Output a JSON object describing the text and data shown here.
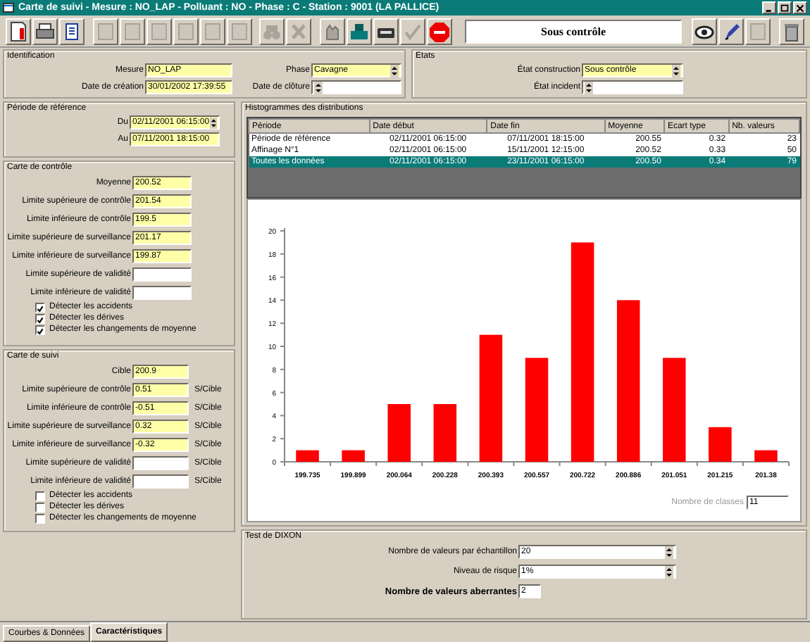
{
  "window": {
    "title": "Carte de suivi - Mesure : NO_LAP - Polluant : NO - Phase : C - Station : 9001 (LA PALLICE)"
  },
  "toolbar": {
    "buttons": [
      {
        "kind": "page",
        "disabled": false
      },
      {
        "kind": "printer",
        "disabled": false
      },
      {
        "kind": "doc",
        "disabled": false
      },
      {
        "kind": "blank",
        "disabled": true
      },
      {
        "kind": "blank",
        "disabled": true
      },
      {
        "kind": "blank",
        "disabled": true
      },
      {
        "kind": "blank",
        "disabled": true
      },
      {
        "kind": "blank",
        "disabled": true
      },
      {
        "kind": "blank",
        "disabled": true
      },
      {
        "kind": "binoculars",
        "disabled": true
      },
      {
        "kind": "cross",
        "disabled": true
      },
      {
        "kind": "hand",
        "disabled": true
      },
      {
        "kind": "machine",
        "disabled": false
      },
      {
        "kind": "tray",
        "disabled": false
      },
      {
        "kind": "check",
        "disabled": true
      },
      {
        "kind": "stop",
        "disabled": false
      }
    ],
    "status": "Sous contrôle",
    "right_buttons": [
      {
        "kind": "eye",
        "disabled": false
      },
      {
        "kind": "pen",
        "disabled": false
      },
      {
        "kind": "blank",
        "disabled": true
      },
      {
        "kind": "trash",
        "disabled": false
      }
    ]
  },
  "identification": {
    "title": "Identification",
    "left_fields": [
      {
        "label": "Mesure",
        "value": "NO_LAP",
        "required": true
      },
      {
        "label": "Date de création",
        "value": "30/01/2002 17:39:55",
        "required": true
      }
    ],
    "right_fields": [
      {
        "label": "Phase",
        "value": "Cavagne",
        "kind": "select",
        "required": true
      },
      {
        "label": "Date de clôture",
        "kind": "select",
        "required": false
      }
    ]
  },
  "etats": {
    "title": "Etats",
    "fields": [
      {
        "label": "État construction",
        "value": "Sous contrôle",
        "kind": "select",
        "required": true
      },
      {
        "label": "État incident",
        "kind": "select",
        "required": false
      }
    ]
  },
  "reference_period": {
    "title": "Période de référence",
    "fields": [
      {
        "label": "Du",
        "value": "02/11/2001 06:15:00",
        "kind": "select",
        "required": true
      },
      {
        "label": "Au",
        "value": "07/11/2001 18:15:00",
        "required": true
      }
    ]
  },
  "control_chart": {
    "title": "Carte de contrôle",
    "fields": [
      {
        "label": "Moyenne",
        "value": "200.52",
        "required": true
      },
      {
        "label": "Limite supérieure de contrôle",
        "value": "201.54",
        "required": true
      },
      {
        "label": "Limite inférieure de contrôle",
        "value": "199.5",
        "required": true
      },
      {
        "label": "Limite supérieure de surveillance",
        "value": "201.17",
        "required": true
      },
      {
        "label": "Limite inférieure de surveillance",
        "value": "199.87",
        "required": true
      },
      {
        "label": "Limite supérieure de validité",
        "required": false
      },
      {
        "label": "Limite inférieure de validité",
        "required": false
      }
    ],
    "checkboxes": [
      {
        "label": "Détecter les accidents",
        "checked": true
      },
      {
        "label": "Détecter les dérives",
        "checked": true
      },
      {
        "label": "Détecter les changements de moyenne",
        "checked": true
      }
    ]
  },
  "tracking_chart": {
    "title": "Carte de suivi",
    "fields": [
      {
        "label": "Cible",
        "value": "200.9",
        "required": true
      },
      {
        "label": "Limite supérieure de contrôle",
        "value": "0.51",
        "unit": "S/Cible",
        "required": true
      },
      {
        "label": "Limite inférieure de contrôle",
        "value": "-0.51",
        "unit": "S/Cible",
        "required": true
      },
      {
        "label": "Limite supérieure de surveillance",
        "value": "0.32",
        "unit": "S/Cible",
        "required": true
      },
      {
        "label": "Limite inférieure de surveillance",
        "value": "-0.32",
        "unit": "S/Cible",
        "required": true
      },
      {
        "label": "Limite supérieure de validité",
        "unit": "S/Cible",
        "required": false
      },
      {
        "label": "Limite inférieure de validité",
        "unit": "S/Cible",
        "required": false
      }
    ],
    "checkboxes": [
      {
        "label": "Détecter les accidents",
        "checked": false
      },
      {
        "label": "Détecter les dérives",
        "checked": false
      },
      {
        "label": "Détecter les changements de moyenne",
        "checked": false
      }
    ]
  },
  "histograms": {
    "title": "Histogrammes des distributions",
    "table": {
      "columns": [
        "Période",
        "Date début",
        "Date fin",
        "Moyenne",
        "Ecart type",
        "Nb. valeurs"
      ],
      "rows": [
        {
          "cells": [
            "Période de référence",
            "02/11/2001 06:15:00",
            "07/11/2001 18:15:00",
            "200.55",
            "0.32",
            "23"
          ],
          "selected": false
        },
        {
          "cells": [
            "Affinage N°1",
            "02/11/2001 06:15:00",
            "15/11/2001 12:15:00",
            "200.52",
            "0.33",
            "50"
          ],
          "selected": false
        },
        {
          "cells": [
            "Toutes les données",
            "02/11/2001 06:15:00",
            "23/11/2001 06:15:00",
            "200.50",
            "0.34",
            "79"
          ],
          "selected": true
        }
      ]
    },
    "chart_data": {
      "type": "bar",
      "categories": [
        "199.735",
        "199.899",
        "200.064",
        "200.228",
        "200.393",
        "200.557",
        "200.722",
        "200.886",
        "201.051",
        "201.215",
        "201.38"
      ],
      "series": [
        {
          "color": "#ff0000",
          "values": [
            1,
            1,
            5,
            5,
            11,
            9,
            19,
            14,
            9,
            3,
            1
          ]
        }
      ],
      "ylim": [
        0,
        20
      ],
      "yticks": [
        0,
        2,
        4,
        6,
        8,
        10,
        12,
        14,
        16,
        18,
        20
      ]
    },
    "classes": {
      "label": "Nombre de classes",
      "value": "11",
      "disabled": true
    }
  },
  "dixon": {
    "title": "Test de DIXON",
    "fields": [
      {
        "label": "Nombre de valeurs par échantillon",
        "value": "20",
        "kind": "select"
      },
      {
        "label": "Niveau de risque",
        "value": "1%",
        "kind": "select"
      },
      {
        "label": "Nombre de valeurs aberrantes",
        "value": "2",
        "kind": "total"
      }
    ]
  },
  "tabs": [
    {
      "label": "Courbes & Données",
      "selected": false
    },
    {
      "label": "Caractéristiques",
      "selected": true
    }
  ]
}
